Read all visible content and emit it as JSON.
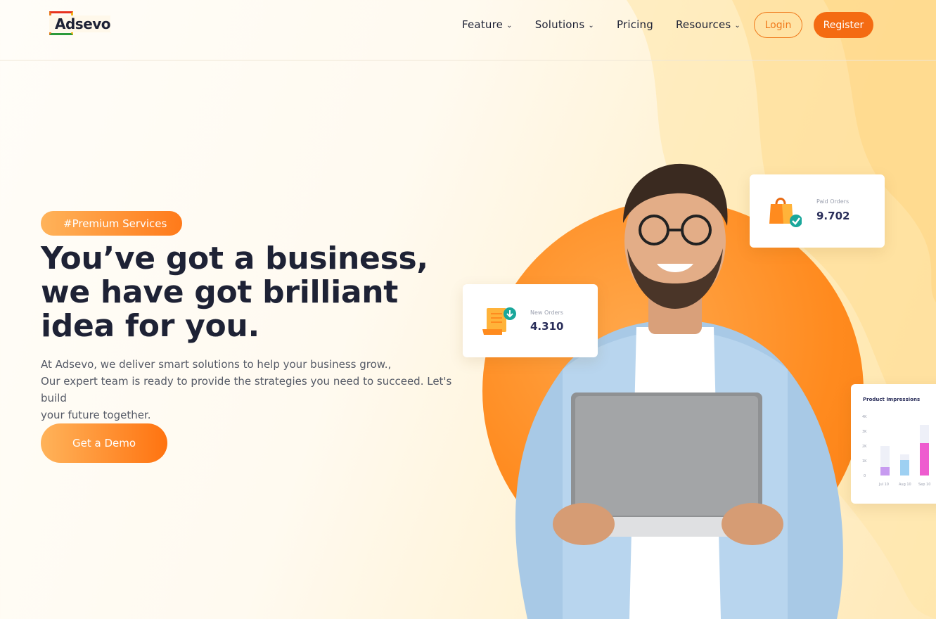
{
  "brand": {
    "name": "Adsevo"
  },
  "nav": {
    "items": [
      {
        "label": "Feature",
        "has_dropdown": true
      },
      {
        "label": "Solutions",
        "has_dropdown": true
      },
      {
        "label": "Pricing",
        "has_dropdown": false
      },
      {
        "label": "Resources",
        "has_dropdown": true
      }
    ],
    "login_label": "Login",
    "register_label": "Register"
  },
  "hero": {
    "badge": "#Premium Services",
    "headline_lines": [
      "You’ve got a business,",
      "we have got brilliant",
      "idea for you."
    ],
    "description_lines": [
      "At Adsevo, we deliver smart solutions to help your business grow.,",
      "Our expert team is ready to provide the strategies you need to succeed. Let's build",
      "your future together."
    ],
    "cta_label": "Get a Demo"
  },
  "stats": {
    "paid_orders": {
      "label": "Paid Orders",
      "value": "9.702"
    },
    "new_orders": {
      "label": "New Orders",
      "value": "4.310"
    },
    "impressions": {
      "title": "Product Impressions",
      "y_ticks": [
        "4K",
        "3K",
        "2K",
        "1K",
        "0"
      ],
      "x_labels": [
        "Jul 10",
        "Aug 10",
        "Sep 10"
      ]
    }
  },
  "colors": {
    "accent": "#f46b12",
    "accent_light": "#ffb35a",
    "text_dark": "#1e2235"
  }
}
